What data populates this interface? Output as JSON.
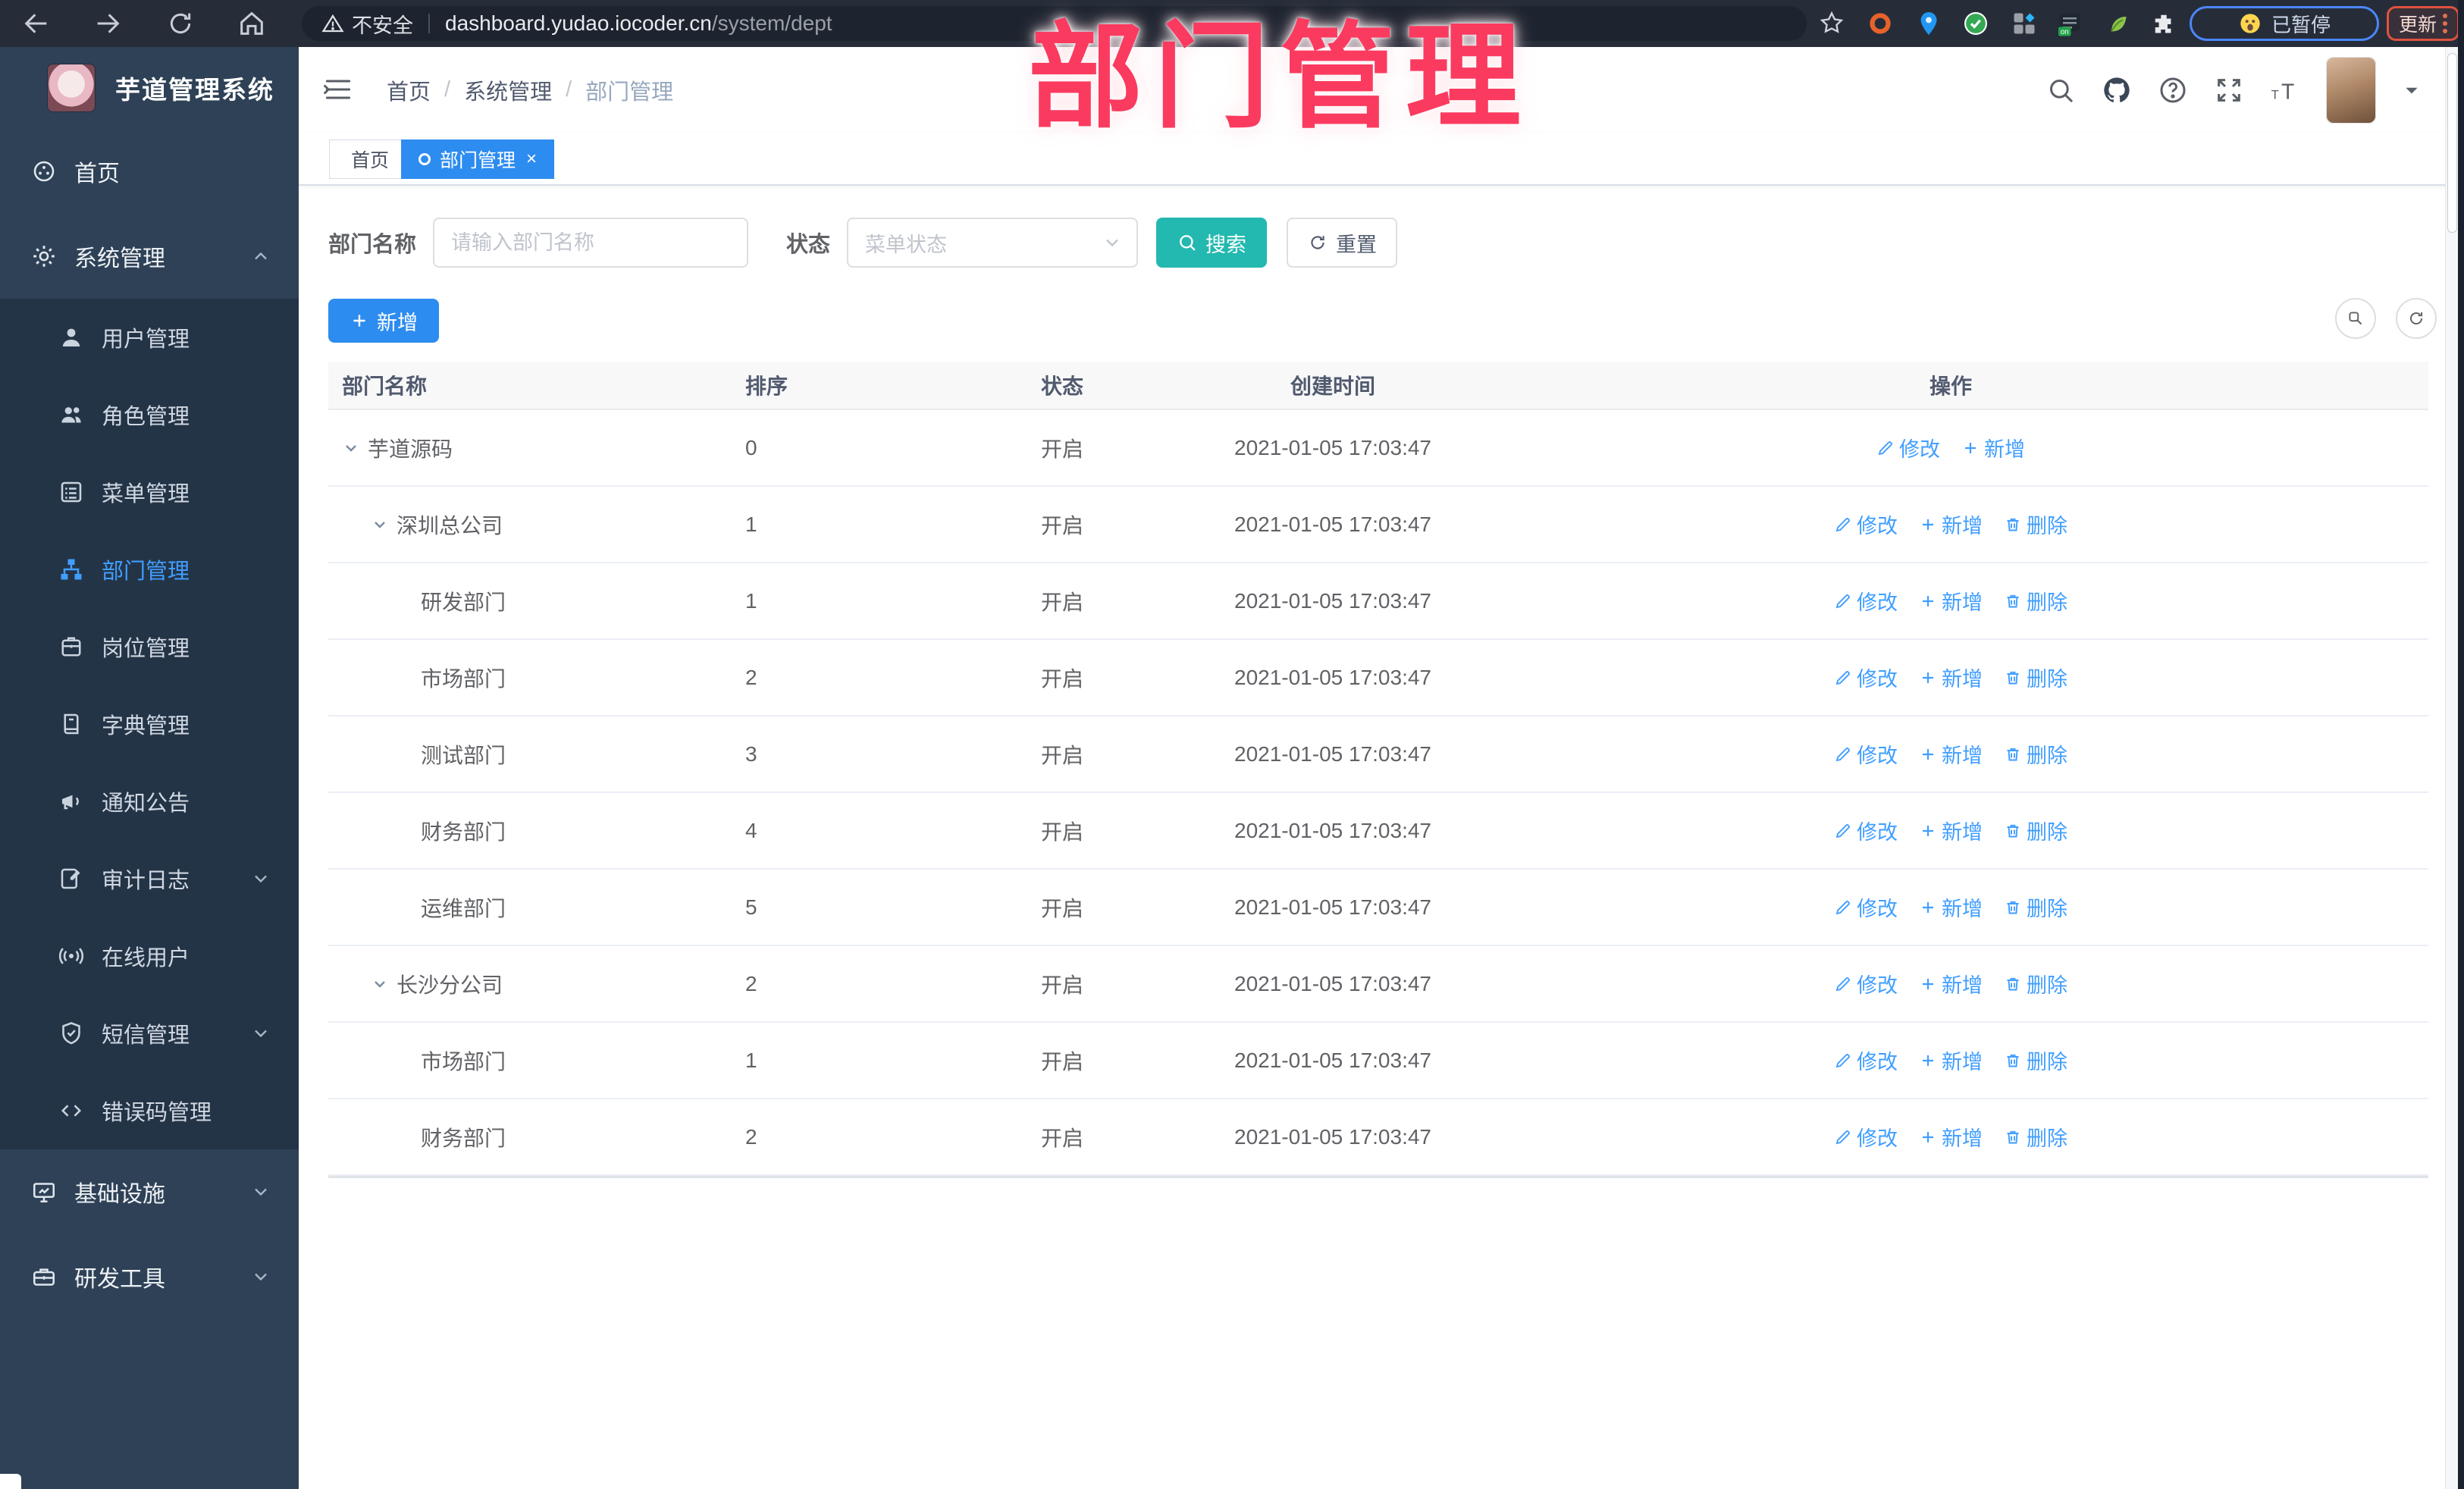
{
  "browser": {
    "security_label": "不安全",
    "url_host": "dashboard.yudao.iocoder.cn",
    "url_path": "/system/dept",
    "paused_label": "已暂停",
    "update_label": "更新"
  },
  "watermark": "部门管理",
  "colors": {
    "primary_blue": "#2d8cf0",
    "link_blue": "#409eff",
    "search_teal": "#23b8b0",
    "watermark_pink": "#fb3a5f",
    "sidebar_bg": "#2e4156",
    "submenu_bg": "#243447"
  },
  "sidebar": {
    "title": "芋道管理系统",
    "items": [
      {
        "key": "home",
        "label": "首页",
        "icon": "dashboard-icon",
        "type": "top"
      },
      {
        "key": "system",
        "label": "系统管理",
        "icon": "gear-icon",
        "type": "top",
        "chevron": "up"
      },
      {
        "key": "user",
        "label": "用户管理",
        "icon": "user-icon",
        "type": "sub"
      },
      {
        "key": "role",
        "label": "角色管理",
        "icon": "users-icon",
        "type": "sub"
      },
      {
        "key": "menu",
        "label": "菜单管理",
        "icon": "menu-list-icon",
        "type": "sub"
      },
      {
        "key": "dept",
        "label": "部门管理",
        "icon": "org-tree-icon",
        "type": "sub",
        "active": true
      },
      {
        "key": "post",
        "label": "岗位管理",
        "icon": "badge-icon",
        "type": "sub"
      },
      {
        "key": "dict",
        "label": "字典管理",
        "icon": "dict-icon",
        "type": "sub"
      },
      {
        "key": "notice",
        "label": "通知公告",
        "icon": "announcement-icon",
        "type": "sub"
      },
      {
        "key": "audit-log",
        "label": "审计日志",
        "icon": "log-icon",
        "type": "sub",
        "chevron": "down"
      },
      {
        "key": "online-user",
        "label": "在线用户",
        "icon": "online-icon",
        "type": "sub"
      },
      {
        "key": "sms",
        "label": "短信管理",
        "icon": "sms-icon",
        "type": "sub",
        "chevron": "down"
      },
      {
        "key": "error-code",
        "label": "错误码管理",
        "icon": "code-icon",
        "type": "sub"
      },
      {
        "key": "infra",
        "label": "基础设施",
        "icon": "infra-icon",
        "type": "top",
        "chevron": "down"
      },
      {
        "key": "dev-tools",
        "label": "研发工具",
        "icon": "tools-icon",
        "type": "top",
        "chevron": "down"
      }
    ]
  },
  "header": {
    "breadcrumb": [
      "首页",
      "系统管理",
      "部门管理"
    ]
  },
  "tabs": [
    {
      "label": "首页",
      "active": false
    },
    {
      "label": "部门管理",
      "active": true,
      "closable": true
    }
  ],
  "filters": {
    "name_label": "部门名称",
    "name_placeholder": "请输入部门名称",
    "status_label": "状态",
    "status_placeholder": "菜单状态",
    "search_label": "搜索",
    "reset_label": "重置"
  },
  "toolbar": {
    "add_label": "新增"
  },
  "table": {
    "columns": [
      "部门名称",
      "排序",
      "状态",
      "创建时间",
      "操作"
    ],
    "action_labels": {
      "edit": "修改",
      "add": "新增",
      "delete": "删除"
    },
    "rows": [
      {
        "name": "芋道源码",
        "level": 0,
        "expandable": true,
        "sort": "0",
        "status": "开启",
        "created": "2021-01-05 17:03:47",
        "actions": [
          "edit",
          "add"
        ]
      },
      {
        "name": "深圳总公司",
        "level": 1,
        "expandable": true,
        "sort": "1",
        "status": "开启",
        "created": "2021-01-05 17:03:47",
        "actions": [
          "edit",
          "add",
          "delete"
        ]
      },
      {
        "name": "研发部门",
        "level": 2,
        "expandable": false,
        "sort": "1",
        "status": "开启",
        "created": "2021-01-05 17:03:47",
        "actions": [
          "edit",
          "add",
          "delete"
        ]
      },
      {
        "name": "市场部门",
        "level": 2,
        "expandable": false,
        "sort": "2",
        "status": "开启",
        "created": "2021-01-05 17:03:47",
        "actions": [
          "edit",
          "add",
          "delete"
        ]
      },
      {
        "name": "测试部门",
        "level": 2,
        "expandable": false,
        "sort": "3",
        "status": "开启",
        "created": "2021-01-05 17:03:47",
        "actions": [
          "edit",
          "add",
          "delete"
        ]
      },
      {
        "name": "财务部门",
        "level": 2,
        "expandable": false,
        "sort": "4",
        "status": "开启",
        "created": "2021-01-05 17:03:47",
        "actions": [
          "edit",
          "add",
          "delete"
        ]
      },
      {
        "name": "运维部门",
        "level": 2,
        "expandable": false,
        "sort": "5",
        "status": "开启",
        "created": "2021-01-05 17:03:47",
        "actions": [
          "edit",
          "add",
          "delete"
        ]
      },
      {
        "name": "长沙分公司",
        "level": 1,
        "expandable": true,
        "sort": "2",
        "status": "开启",
        "created": "2021-01-05 17:03:47",
        "actions": [
          "edit",
          "add",
          "delete"
        ]
      },
      {
        "name": "市场部门",
        "level": 2,
        "expandable": false,
        "sort": "1",
        "status": "开启",
        "created": "2021-01-05 17:03:47",
        "actions": [
          "edit",
          "add",
          "delete"
        ]
      },
      {
        "name": "财务部门",
        "level": 2,
        "expandable": false,
        "sort": "2",
        "status": "开启",
        "created": "2021-01-05 17:03:47",
        "actions": [
          "edit",
          "add",
          "delete"
        ]
      }
    ]
  }
}
